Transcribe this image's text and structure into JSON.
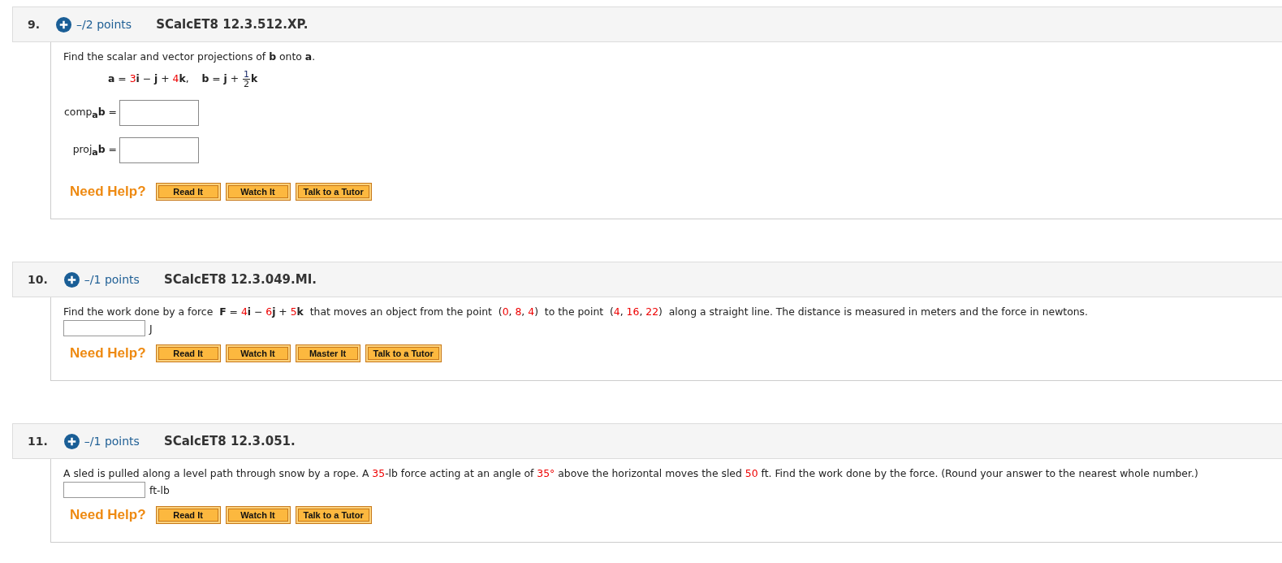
{
  "questions": [
    {
      "number": "9.",
      "points": "–/2 points",
      "code": "SCalcET8 12.3.512.XP.",
      "prompt": [
        {
          "kind": "plain",
          "text": "Find the scalar and vector projections of "
        },
        {
          "kind": "bold",
          "text": "b"
        },
        {
          "kind": "plain",
          "text": " onto "
        },
        {
          "kind": "bold",
          "text": "a"
        },
        {
          "kind": "plain",
          "text": "."
        }
      ],
      "equation": [
        {
          "kind": "bold",
          "text": "a"
        },
        {
          "kind": "plain",
          "text": " = "
        },
        {
          "kind": "red",
          "text": "3"
        },
        {
          "kind": "bold",
          "text": "i"
        },
        {
          "kind": "plain",
          "text": " − "
        },
        {
          "kind": "bold",
          "text": "j"
        },
        {
          "kind": "plain",
          "text": " + "
        },
        {
          "kind": "red",
          "text": "4"
        },
        {
          "kind": "bold",
          "text": "k"
        },
        {
          "kind": "plain",
          "text": ",    "
        },
        {
          "kind": "bold",
          "text": "b"
        },
        {
          "kind": "plain",
          "text": " = "
        },
        {
          "kind": "bold",
          "text": "j"
        },
        {
          "kind": "plain",
          "text": " + "
        },
        {
          "kind": "fraction",
          "numerator": "1",
          "denominator": "2"
        },
        {
          "kind": "bold",
          "text": "k"
        }
      ],
      "answers": [
        {
          "kind": "labeled",
          "label": "comp$_{a}$**b** ="
        },
        {
          "kind": "labeled",
          "label": "proj$_{a}$**b** ="
        }
      ],
      "help_label": "Need Help?",
      "help_buttons": [
        "Read It",
        "Watch It",
        "Talk to a Tutor"
      ]
    },
    {
      "number": "10.",
      "points": "–/1 points",
      "code": "SCalcET8 12.3.049.MI.",
      "prompt": [
        {
          "kind": "plain",
          "text": "Find the work done by a force  "
        },
        {
          "kind": "bold",
          "text": "F"
        },
        {
          "kind": "plain",
          "text": " = "
        },
        {
          "kind": "red",
          "text": "4"
        },
        {
          "kind": "bold",
          "text": "i"
        },
        {
          "kind": "plain",
          "text": " − "
        },
        {
          "kind": "red",
          "text": "6"
        },
        {
          "kind": "bold",
          "text": "j"
        },
        {
          "kind": "plain",
          "text": " + "
        },
        {
          "kind": "red",
          "text": "5"
        },
        {
          "kind": "bold",
          "text": "k"
        },
        {
          "kind": "plain",
          "text": "  that moves an object from the point  ("
        },
        {
          "kind": "red",
          "text": "0"
        },
        {
          "kind": "plain",
          "text": ", "
        },
        {
          "kind": "red",
          "text": "8"
        },
        {
          "kind": "plain",
          "text": ", "
        },
        {
          "kind": "red",
          "text": "4"
        },
        {
          "kind": "plain",
          "text": ")  to the point  ("
        },
        {
          "kind": "red",
          "text": "4"
        },
        {
          "kind": "plain",
          "text": ", "
        },
        {
          "kind": "red",
          "text": "16"
        },
        {
          "kind": "plain",
          "text": ", "
        },
        {
          "kind": "red",
          "text": "22"
        },
        {
          "kind": "plain",
          "text": ")  along a straight line. The distance is measured in meters and the force in newtons."
        }
      ],
      "answers": [
        {
          "kind": "unit",
          "label": "J"
        }
      ],
      "help_label": "Need Help?",
      "help_buttons": [
        "Read It",
        "Watch It",
        "Master It",
        "Talk to a Tutor"
      ]
    },
    {
      "number": "11.",
      "points": "–/1 points",
      "code": "SCalcET8 12.3.051.",
      "prompt": [
        {
          "kind": "plain",
          "text": "A sled is pulled along a level path through snow by a rope. A "
        },
        {
          "kind": "red",
          "text": "35"
        },
        {
          "kind": "plain",
          "text": "-lb force acting at an angle of "
        },
        {
          "kind": "red",
          "text": "35°"
        },
        {
          "kind": "plain",
          "text": " above the horizontal moves the sled "
        },
        {
          "kind": "red",
          "text": "50"
        },
        {
          "kind": "plain",
          "text": " ft. Find the work done by the force. (Round your answer to the nearest whole number.)"
        }
      ],
      "answers": [
        {
          "kind": "unit",
          "label": "ft-lb"
        }
      ],
      "help_label": "Need Help?",
      "help_buttons": [
        "Read It",
        "Watch It",
        "Talk to a Tutor"
      ]
    }
  ]
}
